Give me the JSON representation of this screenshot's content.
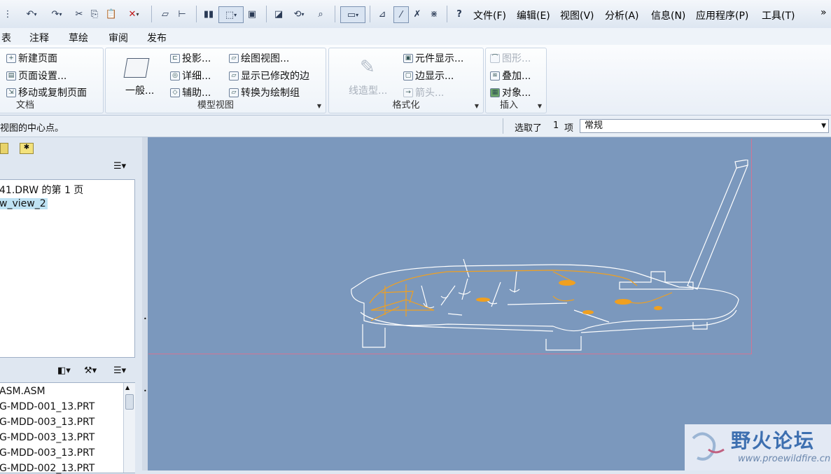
{
  "menubar": [
    "文件(F)",
    "编辑(E)",
    "视图(V)",
    "分析(A)",
    "信息(N)",
    "应用程序(P)",
    "工具(T)"
  ],
  "more_glyph": "»",
  "tabs": [
    "表",
    "注释",
    "草绘",
    "审阅",
    "发布"
  ],
  "ribbon": {
    "document": {
      "title": "文档",
      "items": [
        "新建页面",
        "页面设置...",
        "移动或复制页面"
      ]
    },
    "model_view": {
      "title": "模型视图",
      "general": "一般...",
      "items": [
        "投影...",
        "详细...",
        "辅助...",
        "绘图视图...",
        "显示已修改的边",
        "转换为绘制组"
      ]
    },
    "format": {
      "title": "格式化",
      "hatching": "线造型...",
      "items": [
        "元件显示...",
        "边显示...",
        "箭头..."
      ]
    },
    "insert": {
      "title": "插入",
      "items": [
        "图形...",
        "叠加...",
        "对象..."
      ]
    }
  },
  "status": {
    "message": "视图的中心点。",
    "selected_prefix": "选取了",
    "selected_count": "1",
    "selected_suffix": "项",
    "filter_value": "常规"
  },
  "model_tree": {
    "items": [
      "41.DRW 的第 1 页",
      "w_view_2"
    ]
  },
  "layer_tree": {
    "items": [
      "ASM.ASM",
      "G-MDD-001_13.PRT",
      "G-MDD-003_13.PRT",
      "G-MDD-003_13.PRT",
      "G-MDD-003_13.PRT",
      "G-MDD-002_13.PRT"
    ]
  },
  "watermark": {
    "text": "野火论坛",
    "url": "www.proewildfire.cn"
  },
  "colors": {
    "canvas": "#7b98bd",
    "sheet_border": "#d07595",
    "model_white": "#ffffff",
    "model_orange": "#f0a020",
    "selected_bg": "#bfe3f4"
  }
}
